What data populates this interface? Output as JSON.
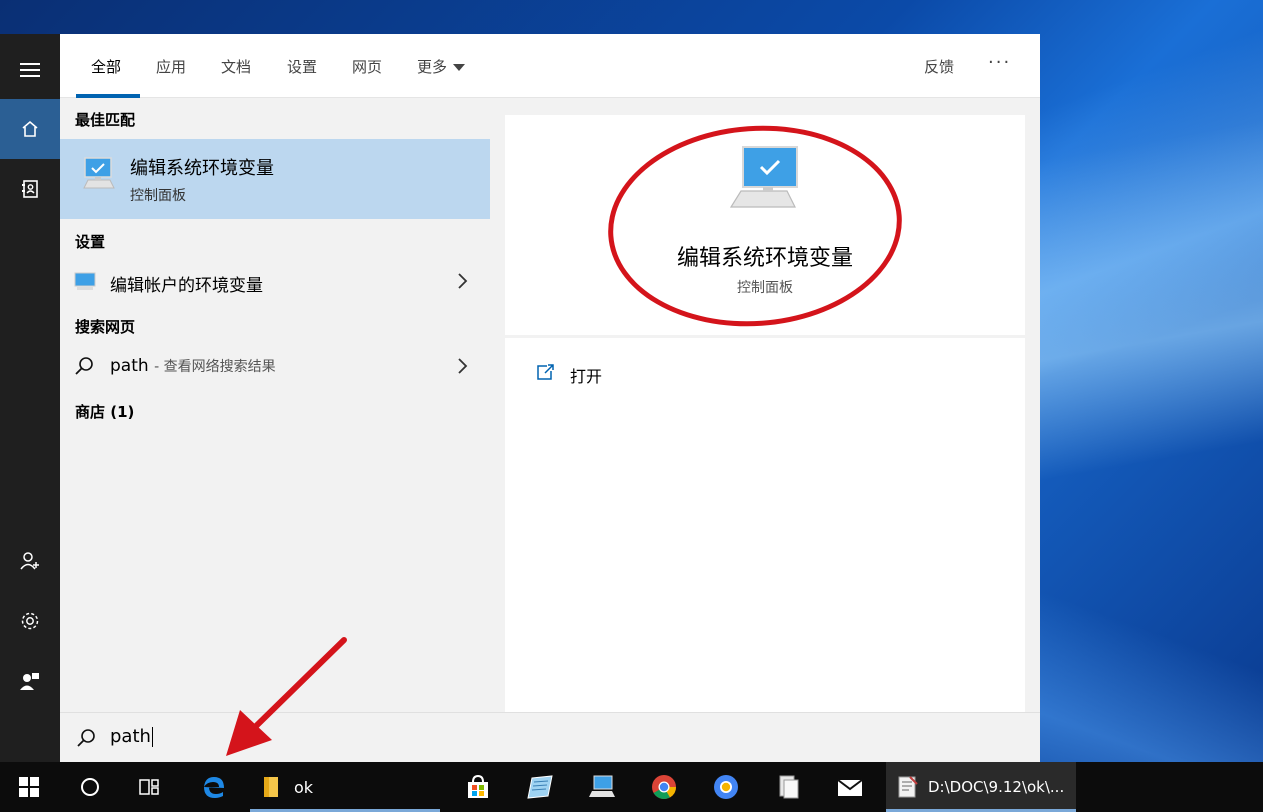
{
  "tabs": [
    {
      "label": "全部",
      "active": true
    },
    {
      "label": "应用"
    },
    {
      "label": "文档"
    },
    {
      "label": "设置"
    },
    {
      "label": "网页"
    },
    {
      "label": "更多"
    }
  ],
  "topbar": {
    "feedback": "反馈",
    "more_dots": "···"
  },
  "results": {
    "best_match_header": "最佳匹配",
    "best_match": {
      "title": "编辑系统环境变量",
      "subtitle": "控制面板",
      "icon": "monitor-check-icon"
    },
    "settings_header": "设置",
    "settings_item": {
      "title": "编辑帐户的环境变量",
      "icon": "monitor-icon"
    },
    "web_header": "搜索网页",
    "web_item": {
      "query": "path",
      "hint": "- 查看网络搜索结果",
      "icon": "search-icon"
    },
    "store_header": "商店 (1)"
  },
  "preview": {
    "title": "编辑系统环境变量",
    "subtitle": "控制面板",
    "icon": "monitor-check-icon"
  },
  "actions": {
    "open_label": "打开",
    "open_icon": "open-external-icon"
  },
  "search": {
    "value": "path",
    "icon": "search-icon"
  },
  "rail": [
    "hamburger-icon",
    "home-icon",
    "notebook-icon",
    "user-add-icon",
    "gear-icon",
    "feedback-person-icon"
  ],
  "taskbar": {
    "folder_label": "ok",
    "active_window_label": "D:\\DOC\\9.12\\ok\\..."
  },
  "colors": {
    "accent": "#0063b1",
    "selected_row": "#bcd7ef",
    "annotation_red": "#d4141b",
    "rail_bg": "#1f1f1f",
    "taskbar_bg": "#0c0c0c"
  }
}
